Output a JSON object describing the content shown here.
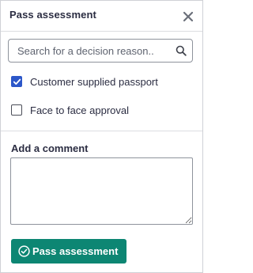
{
  "header": {
    "title": "Pass assessment",
    "close_icon": "close-icon"
  },
  "search": {
    "placeholder": "Search for a decision reason..",
    "value": "",
    "icon": "search-icon"
  },
  "reasons": [
    {
      "label": "Customer supplied passport",
      "checked": true
    },
    {
      "label": "Face to face approval",
      "checked": false
    }
  ],
  "comment": {
    "label": "Add a comment",
    "value": ""
  },
  "submit": {
    "label": "Pass assessment",
    "icon": "check-circle-icon"
  },
  "colors": {
    "accent": "#2c57c9",
    "submit_bg": "#0d8673",
    "text": "#2b2d42",
    "border": "#8e939c"
  }
}
